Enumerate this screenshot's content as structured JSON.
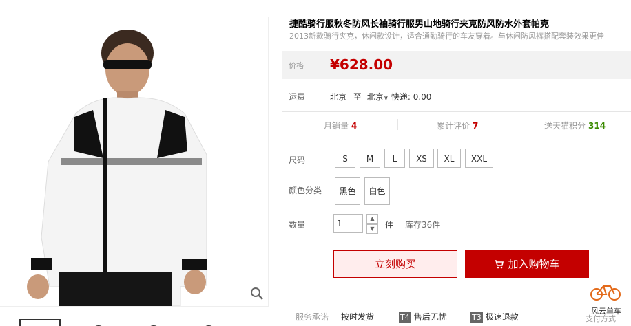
{
  "product": {
    "title": "捷酷骑行服秋冬防风长袖骑行服男山地骑行夹克防风防水外套帕克",
    "subtitle": "2013新款骑行夹克，休闲款设计，适合通勤骑行的车友穿着。与休闲防风裤搭配套装效果更佳"
  },
  "price": {
    "label": "价格",
    "value": "¥628.00"
  },
  "shipping": {
    "label": "运费",
    "from": "北京",
    "to_word": "至",
    "to": "北京",
    "method": "快递: 0.00"
  },
  "stats": {
    "monthly_sales_label": "月销量",
    "monthly_sales_value": "4",
    "reviews_label": "累计评价",
    "reviews_value": "7",
    "points_label": "送天猫积分",
    "points_value": "314"
  },
  "size": {
    "label": "尺码",
    "options": [
      "S",
      "M",
      "L",
      "XS",
      "XL",
      "XXL"
    ]
  },
  "color": {
    "label": "颜色分类",
    "options": [
      "黑色",
      "白色"
    ]
  },
  "quantity": {
    "label": "数量",
    "value": "1",
    "unit": "件",
    "stock": "库存36件"
  },
  "actions": {
    "buy_now": "立刻购买",
    "add_cart": "加入购物车"
  },
  "services": {
    "label": "服务承诺",
    "items": [
      {
        "badge": "",
        "text": "按时发货"
      },
      {
        "badge": "T4",
        "text": "售后无忧"
      },
      {
        "badge": "T3",
        "text": "极速退款"
      }
    ],
    "payment_label": "支付方式"
  },
  "brand_logo": {
    "text": "风云单车"
  },
  "colors": {
    "accent": "#c40000",
    "price_bg": "#f2f2f2",
    "points": "#3a8a00"
  },
  "icons": {
    "zoom": "magnifier-icon",
    "cart": "cart-icon",
    "arrow": "chevron-down-icon"
  }
}
